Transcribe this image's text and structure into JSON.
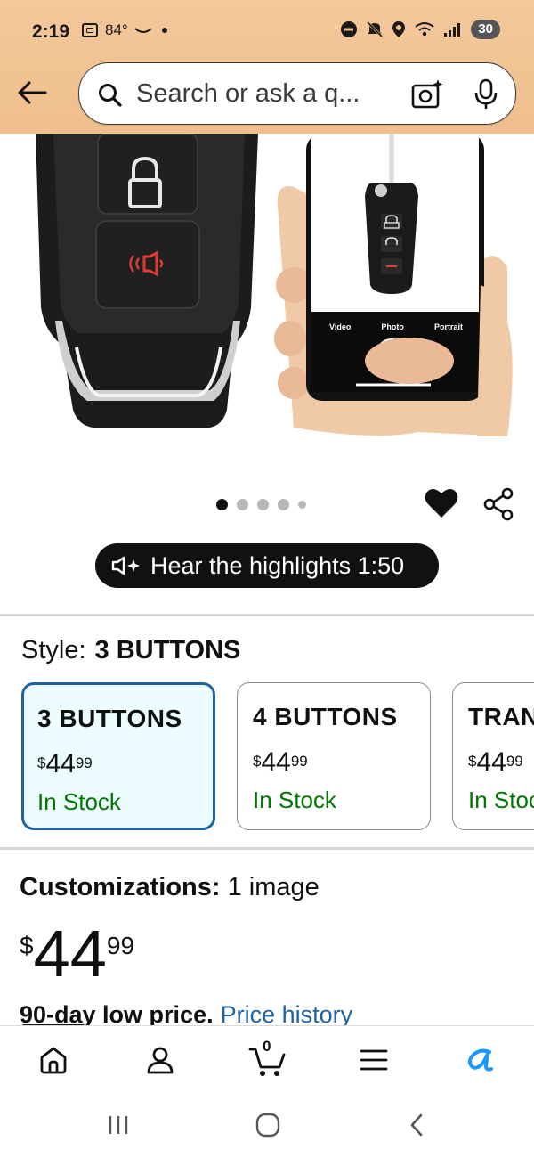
{
  "status_bar": {
    "time": "2:19",
    "temperature": "84°",
    "battery": "30"
  },
  "search": {
    "placeholder": "Search or ask a q..."
  },
  "gallery": {
    "phone_camera_modes": [
      "Video",
      "Photo",
      "Portrait"
    ],
    "page_count": 5,
    "active_page": 1
  },
  "highlights": {
    "label": "Hear the highlights 1:50"
  },
  "style": {
    "label": "Style:",
    "selected_value": "3 BUTTONS",
    "options": [
      {
        "name": "3 BUTTONS",
        "currency": "$",
        "whole": "44",
        "fraction": "99",
        "stock": "In Stock",
        "selected": true
      },
      {
        "name": "4 BUTTONS",
        "currency": "$",
        "whole": "44",
        "fraction": "99",
        "stock": "In Stock",
        "selected": false
      },
      {
        "name": "TRANSPONDER",
        "currency": "$",
        "whole": "44",
        "fraction": "99",
        "stock": "In Stock",
        "selected": false
      }
    ]
  },
  "customizations": {
    "label": "Customizations:",
    "value": "1 image"
  },
  "price": {
    "currency": "$",
    "whole": "44",
    "fraction": "99"
  },
  "low_price": {
    "badge": "90-day low price.",
    "link": "Price history"
  },
  "bottom_nav": {
    "cart_count": "0",
    "items": [
      "home",
      "account",
      "cart",
      "menu",
      "rufus"
    ]
  },
  "colors": {
    "header_bg": "#efbf8d",
    "selected_border": "#2162a1",
    "stock_green": "#007600",
    "link_blue": "#2162a1",
    "rufus_blue": "#1a98ff"
  }
}
